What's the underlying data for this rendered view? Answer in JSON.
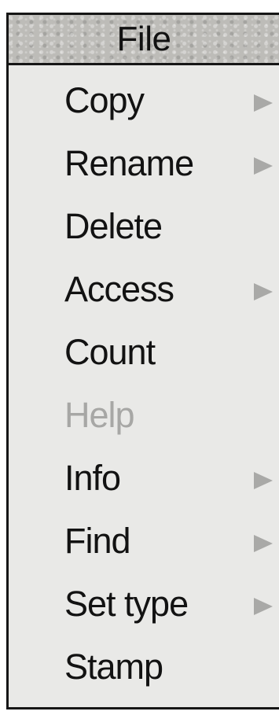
{
  "menu": {
    "title": "File",
    "items": [
      {
        "label": "Copy",
        "submenu": true,
        "enabled": true
      },
      {
        "label": "Rename",
        "submenu": true,
        "enabled": true
      },
      {
        "label": "Delete",
        "submenu": false,
        "enabled": true
      },
      {
        "label": "Access",
        "submenu": true,
        "enabled": true
      },
      {
        "label": "Count",
        "submenu": false,
        "enabled": true
      },
      {
        "label": "Help",
        "submenu": false,
        "enabled": false
      },
      {
        "label": "Info",
        "submenu": true,
        "enabled": true
      },
      {
        "label": "Find",
        "submenu": true,
        "enabled": true
      },
      {
        "label": "Set type",
        "submenu": true,
        "enabled": true
      },
      {
        "label": "Stamp",
        "submenu": false,
        "enabled": true
      }
    ]
  },
  "icons": {
    "submenu": "submenu-arrow-icon"
  },
  "colors": {
    "text": "#121212",
    "disabled_text": "#a7a7a5",
    "menu_background": "#e9e9e7",
    "title_background": "#bdbcb8",
    "border": "#161616",
    "arrow": "#a9a9a7"
  }
}
